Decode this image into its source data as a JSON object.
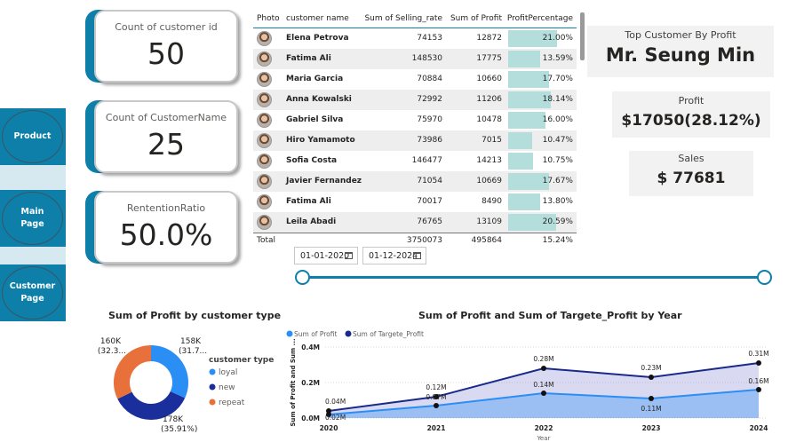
{
  "nav": {
    "items": [
      {
        "label": "Product"
      },
      {
        "label": "Main\nPage"
      },
      {
        "label": "Customer\nPage"
      }
    ]
  },
  "kpis": [
    {
      "label": "Count of customer id",
      "value": "50"
    },
    {
      "label": "Count of CustomerName",
      "value": "25"
    },
    {
      "label": "RententionRatio",
      "value": "50.0%"
    }
  ],
  "table": {
    "headers": {
      "photo": "Photo",
      "name": "customer name",
      "selling": "Sum of Selling_rate",
      "profit": "Sum of Profit",
      "pct": "ProfitPercentage"
    },
    "rows": [
      {
        "name": "Elena Petrova",
        "selling": "74153",
        "profit": "12872",
        "pct": "21.00%",
        "pct_value": 21.0
      },
      {
        "name": "Fatima Ali",
        "selling": "148530",
        "profit": "17775",
        "pct": "13.59%",
        "pct_value": 13.59
      },
      {
        "name": "Maria Garcia",
        "selling": "70884",
        "profit": "10660",
        "pct": "17.70%",
        "pct_value": 17.7
      },
      {
        "name": "Anna Kowalski",
        "selling": "72992",
        "profit": "11206",
        "pct": "18.14%",
        "pct_value": 18.14
      },
      {
        "name": "Gabriel Silva",
        "selling": "75970",
        "profit": "10478",
        "pct": "16.00%",
        "pct_value": 16.0
      },
      {
        "name": "Hiro Yamamoto",
        "selling": "73986",
        "profit": "7015",
        "pct": "10.47%",
        "pct_value": 10.47
      },
      {
        "name": "Sofia Costa",
        "selling": "146477",
        "profit": "14213",
        "pct": "10.75%",
        "pct_value": 10.75
      },
      {
        "name": "Javier Fernandez",
        "selling": "71054",
        "profit": "10669",
        "pct": "17.67%",
        "pct_value": 17.67
      },
      {
        "name": "Fatima Ali",
        "selling": "70017",
        "profit": "8490",
        "pct": "13.80%",
        "pct_value": 13.8
      },
      {
        "name": "Leila Abadi",
        "selling": "76765",
        "profit": "13109",
        "pct": "20.59%",
        "pct_value": 20.59
      }
    ],
    "total": {
      "label": "Total",
      "selling": "3750073",
      "profit": "495864",
      "pct": "15.24%"
    }
  },
  "top_customer": {
    "label": "Top Customer By Profit",
    "value": "Mr. Seung Min"
  },
  "profit_box": {
    "label": "Profit",
    "value": "$17050(28.12%)"
  },
  "sales_box": {
    "label": "Sales",
    "value": "$ 77681"
  },
  "date_slicer": {
    "start": "01-01-2020",
    "end": "01-12-2024"
  },
  "colors": {
    "accent": "#0d7fa9",
    "loyal": "#2b8ef5",
    "new": "#1a2f9c",
    "repeat": "#e8703a",
    "profit_line": "#2b8ef5",
    "target_line": "#1a2a8a"
  },
  "chart_data": [
    {
      "type": "pie",
      "title": "Sum of Profit by customer type",
      "legend_title": "customer type",
      "legend_position": "right",
      "slices": [
        {
          "name": "loyal",
          "value": 158,
          "label": "158K",
          "pct_label": "(31.7...",
          "color": "#2b8ef5"
        },
        {
          "name": "new",
          "value": 178,
          "label": "178K",
          "pct_label": "(35.91%)",
          "color": "#1a2f9c"
        },
        {
          "name": "repeat",
          "value": 160,
          "label": "160K",
          "pct_label": "(32.3...",
          "color": "#e8703a"
        }
      ]
    },
    {
      "type": "area",
      "title": "Sum of Profit and Sum of Targete_Profit by Year",
      "xlabel": "Year",
      "ylabel": "Sum of Profit and Sum ...",
      "x": [
        2020,
        2021,
        2022,
        2023,
        2024
      ],
      "ylim": [
        0,
        0.4
      ],
      "yticks": [
        "0.0M",
        "0.2M",
        "0.4M"
      ],
      "ytick_values": [
        0,
        0.2,
        0.4
      ],
      "legend_position": "top-left",
      "series": [
        {
          "name": "Sum of Profit",
          "values": [
            0.02,
            0.07,
            0.14,
            0.11,
            0.16
          ],
          "labels": [
            "0.02M",
            "0.07M",
            "0.14M",
            "0.11M",
            "0.16M"
          ],
          "color": "#2b8ef5"
        },
        {
          "name": "Sum of Targete_Profit",
          "values": [
            0.04,
            0.12,
            0.28,
            0.23,
            0.31
          ],
          "labels": [
            "0.04M",
            "0.12M",
            "0.28M",
            "0.23M",
            "0.31M"
          ],
          "color": "#1a2a8a"
        }
      ]
    }
  ]
}
